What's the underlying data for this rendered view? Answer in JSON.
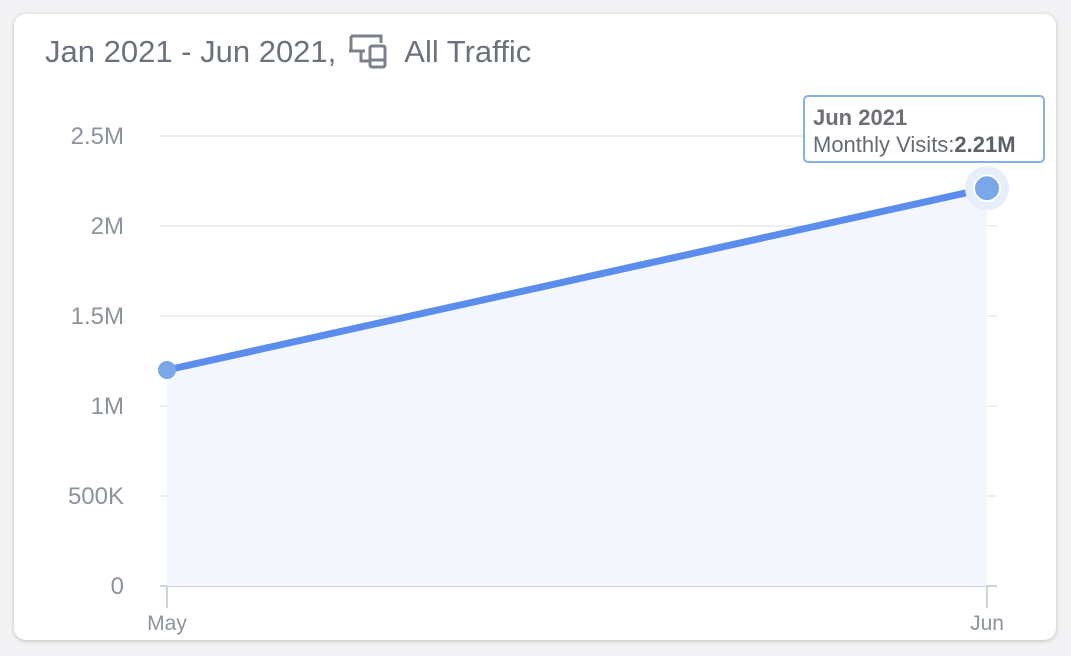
{
  "header": {
    "date_range": "Jan 2021 - Jun 2021",
    "separator": ",",
    "traffic_label": "All Traffic",
    "device_icon": "multi-device-icon"
  },
  "tooltip": {
    "title": "Jun 2021",
    "label": "Monthly Visits:",
    "value": "2.21M"
  },
  "colors": {
    "line": "#5b8ded",
    "point": "#7aa7e8",
    "area": "#f3f6fd",
    "grid": "#e8e9ed",
    "axis_text": "#8d939c",
    "text": "#6b727c"
  },
  "chart_data": {
    "type": "area",
    "x": [
      "May",
      "Jun"
    ],
    "series": [
      {
        "values": [
          1200000,
          2210000
        ]
      }
    ],
    "y_ticks": [
      0,
      500000,
      1000000,
      1500000,
      2000000,
      2500000
    ],
    "y_tick_labels": [
      "0",
      "500K",
      "1M",
      "1.5M",
      "2M",
      "2.5M"
    ],
    "ylim": [
      0,
      2500000
    ],
    "grid": true,
    "highlighted_point": "Jun"
  }
}
